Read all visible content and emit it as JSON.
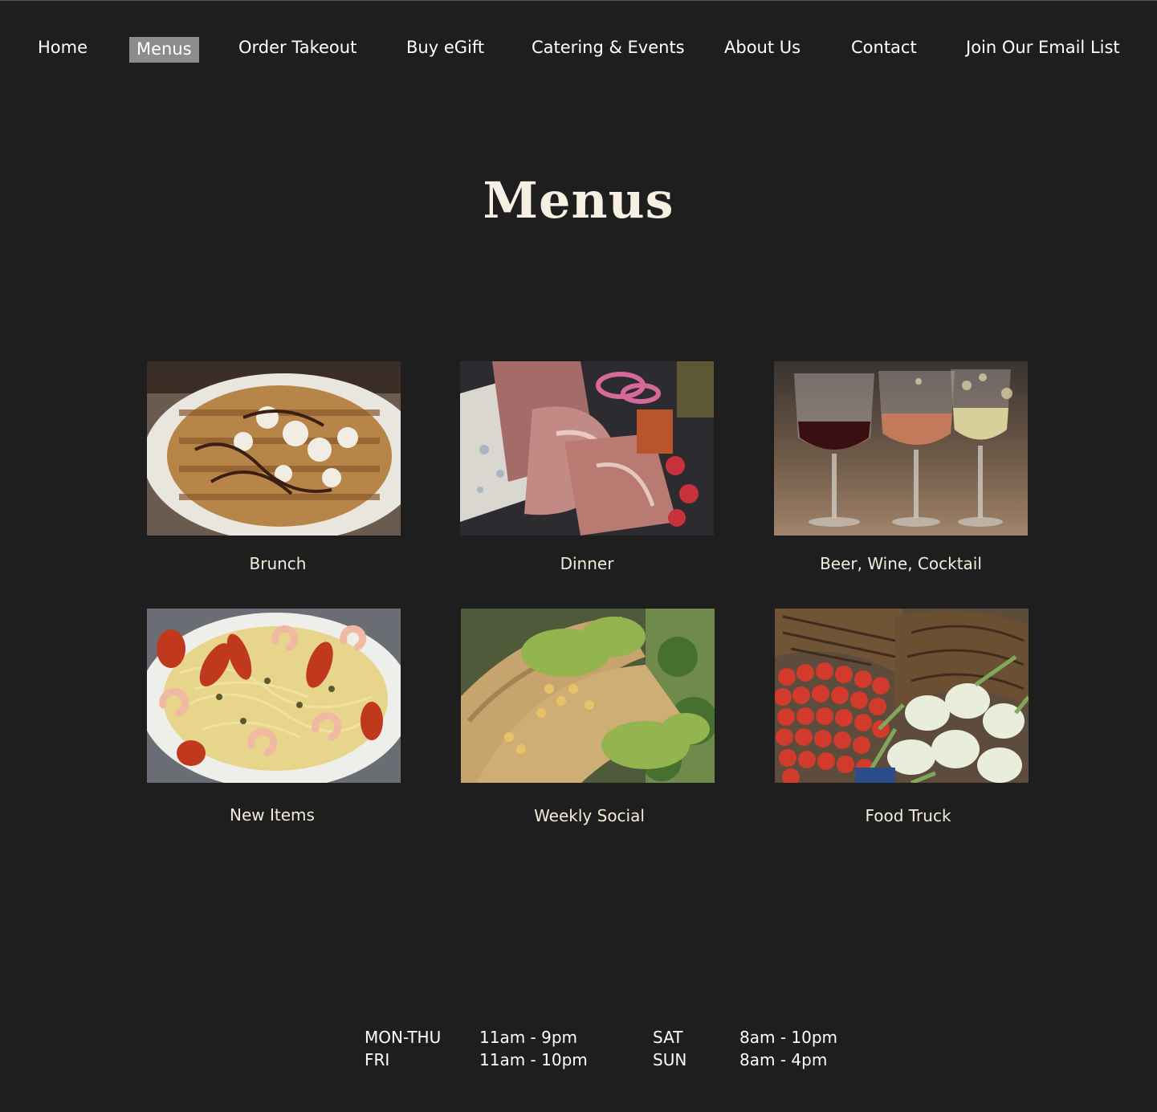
{
  "nav": {
    "items": [
      {
        "label": "Home"
      },
      {
        "label": "Menus",
        "active": true
      },
      {
        "label": "Order Takeout"
      },
      {
        "label": "Buy eGift"
      },
      {
        "label": "Catering & Events"
      },
      {
        "label": "About Us"
      },
      {
        "label": "Contact"
      },
      {
        "label": "Join Our Email List"
      }
    ],
    "active_bg": "#8c8c8c"
  },
  "page": {
    "title": "Menus",
    "background": "#1e1e1e",
    "title_color": "#f6f0e2"
  },
  "menus": [
    {
      "label": "Brunch",
      "image": "waffle-photo"
    },
    {
      "label": "Dinner",
      "image": "charcuterie-photo"
    },
    {
      "label": "Beer, Wine, Cocktail",
      "image": "wine-glasses-photo"
    },
    {
      "label": "New Items",
      "image": "shrimp-pasta-photo"
    },
    {
      "label": "Weekly Social",
      "image": "tacos-photo"
    },
    {
      "label": "Food Truck",
      "image": "produce-baskets-photo"
    }
  ],
  "hours": {
    "rows": [
      {
        "day1": "MON-THU",
        "time1": "11am - 9pm",
        "day2": "SAT",
        "time2": "8am - 10pm"
      },
      {
        "day1": "FRI",
        "time1": "11am - 10pm",
        "day2": "SUN",
        "time2": "8am - 4pm"
      }
    ]
  }
}
